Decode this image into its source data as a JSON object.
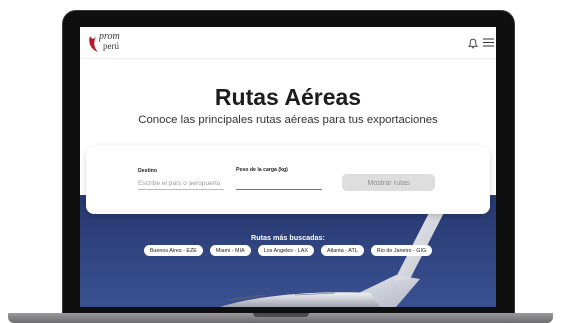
{
  "brand": {
    "logo_line1": "prom",
    "logo_line2": "perú",
    "accent": "#b5182a"
  },
  "hero": {
    "title": "Rutas Aéreas",
    "subtitle": "Conoce las principales rutas aéreas para tus exportaciones"
  },
  "search": {
    "destino_label": "Destino",
    "destino_placeholder": "Escribe el país o aeropuerto",
    "destino_value": "",
    "peso_label": "Peso de la carga (kg)",
    "peso_value": "",
    "submit_label": "Mostrar rutas"
  },
  "popular": {
    "title": "Rutas más buscadas:",
    "routes": [
      "Buenos Aires - EZE",
      "Miami - MIA",
      "Los Angeles - LAX",
      "Atlanta - ATL",
      "Rio de Janeiro - GIG"
    ]
  },
  "icons": {
    "notifications": "bell-icon",
    "menu": "hamburger-menu-icon"
  }
}
